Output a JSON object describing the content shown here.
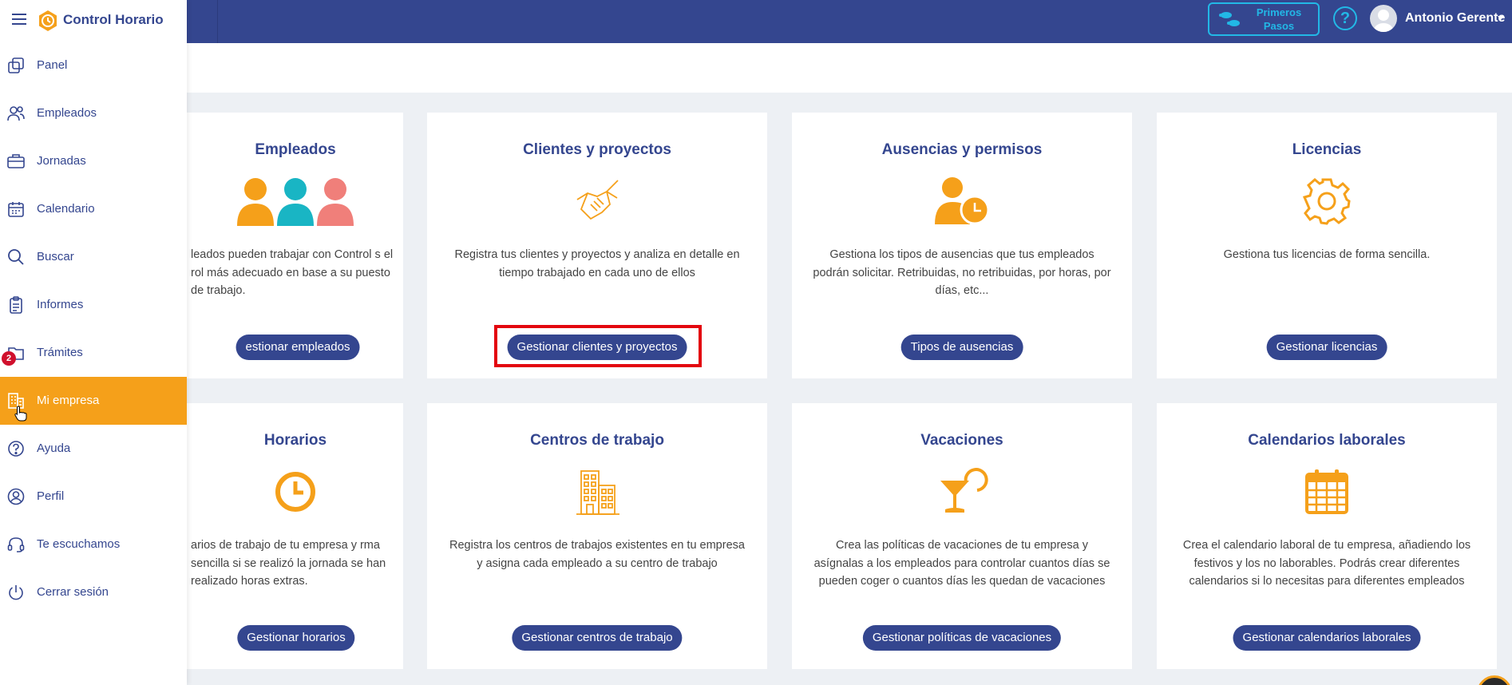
{
  "app": {
    "title": "Control Horario"
  },
  "header": {
    "first_steps_line1": "Primeros",
    "first_steps_line2": "Pasos",
    "help_symbol": "?",
    "user_name": "Antonio Gerente"
  },
  "sidebar": {
    "items": [
      {
        "label": "Panel",
        "icon": "panel-icon"
      },
      {
        "label": "Empleados",
        "icon": "users-icon"
      },
      {
        "label": "Jornadas",
        "icon": "briefcase-icon"
      },
      {
        "label": "Calendario",
        "icon": "calendar-icon"
      },
      {
        "label": "Buscar",
        "icon": "search-icon"
      },
      {
        "label": "Informes",
        "icon": "clipboard-icon"
      },
      {
        "label": "Trámites",
        "icon": "folder-icon",
        "badge": "2"
      },
      {
        "label": "Mi empresa",
        "icon": "building-icon",
        "active": true
      },
      {
        "label": "Ayuda",
        "icon": "help-circle-icon"
      },
      {
        "label": "Perfil",
        "icon": "user-circle-icon"
      },
      {
        "label": "Te escuchamos",
        "icon": "headset-icon"
      },
      {
        "label": "Cerrar sesión",
        "icon": "power-icon"
      }
    ]
  },
  "cards": [
    {
      "title": "Empleados",
      "desc": "leados pueden trabajar con Control s el rol más adecuado en base a su puesto de trabajo.",
      "button": "estionar empleados"
    },
    {
      "title": "Clientes y proyectos",
      "desc": "Registra tus clientes y proyectos y analiza en detalle en tiempo trabajado en cada uno de ellos",
      "button": "Gestionar clientes y proyectos"
    },
    {
      "title": "Ausencias y permisos",
      "desc": "Gestiona los tipos de ausencias que tus empleados podrán solicitar. Retribuidas, no retribuidas, por horas, por días, etc...",
      "button": "Tipos de ausencias"
    },
    {
      "title": "Licencias",
      "desc": "Gestiona tus licencias de forma sencilla.",
      "button": "Gestionar licencias"
    },
    {
      "title": "Horarios",
      "desc": "arios de trabajo de tu empresa y rma sencilla si se realizó la jornada se han realizado horas extras.",
      "button": "Gestionar horarios"
    },
    {
      "title": "Centros de trabajo",
      "desc": "Registra los centros de trabajos existentes en tu empresa y asigna cada empleado a su centro de trabajo",
      "button": "Gestionar centros de trabajo"
    },
    {
      "title": "Vacaciones",
      "desc": "Crea las políticas de vacaciones de tu empresa y asígnalas a los empleados para controlar cuantos días se pueden coger o cuantos días les quedan de vacaciones",
      "button": "Gestionar políticas de vacaciones"
    },
    {
      "title": "Calendarios laborales",
      "desc": "Crea el calendario laboral de tu empresa, añadiendo los festivos y los no laborables. Podrás crear diferentes calendarios si lo necesitas para diferentes empleados",
      "button": "Gestionar calendarios laborales"
    }
  ],
  "colors": {
    "primary": "#34468f",
    "accent": "#f5a01a",
    "teal": "#19b5c4",
    "salmon": "#f07f7a",
    "highlight": "#e3060e",
    "badge": "#d0102d"
  }
}
